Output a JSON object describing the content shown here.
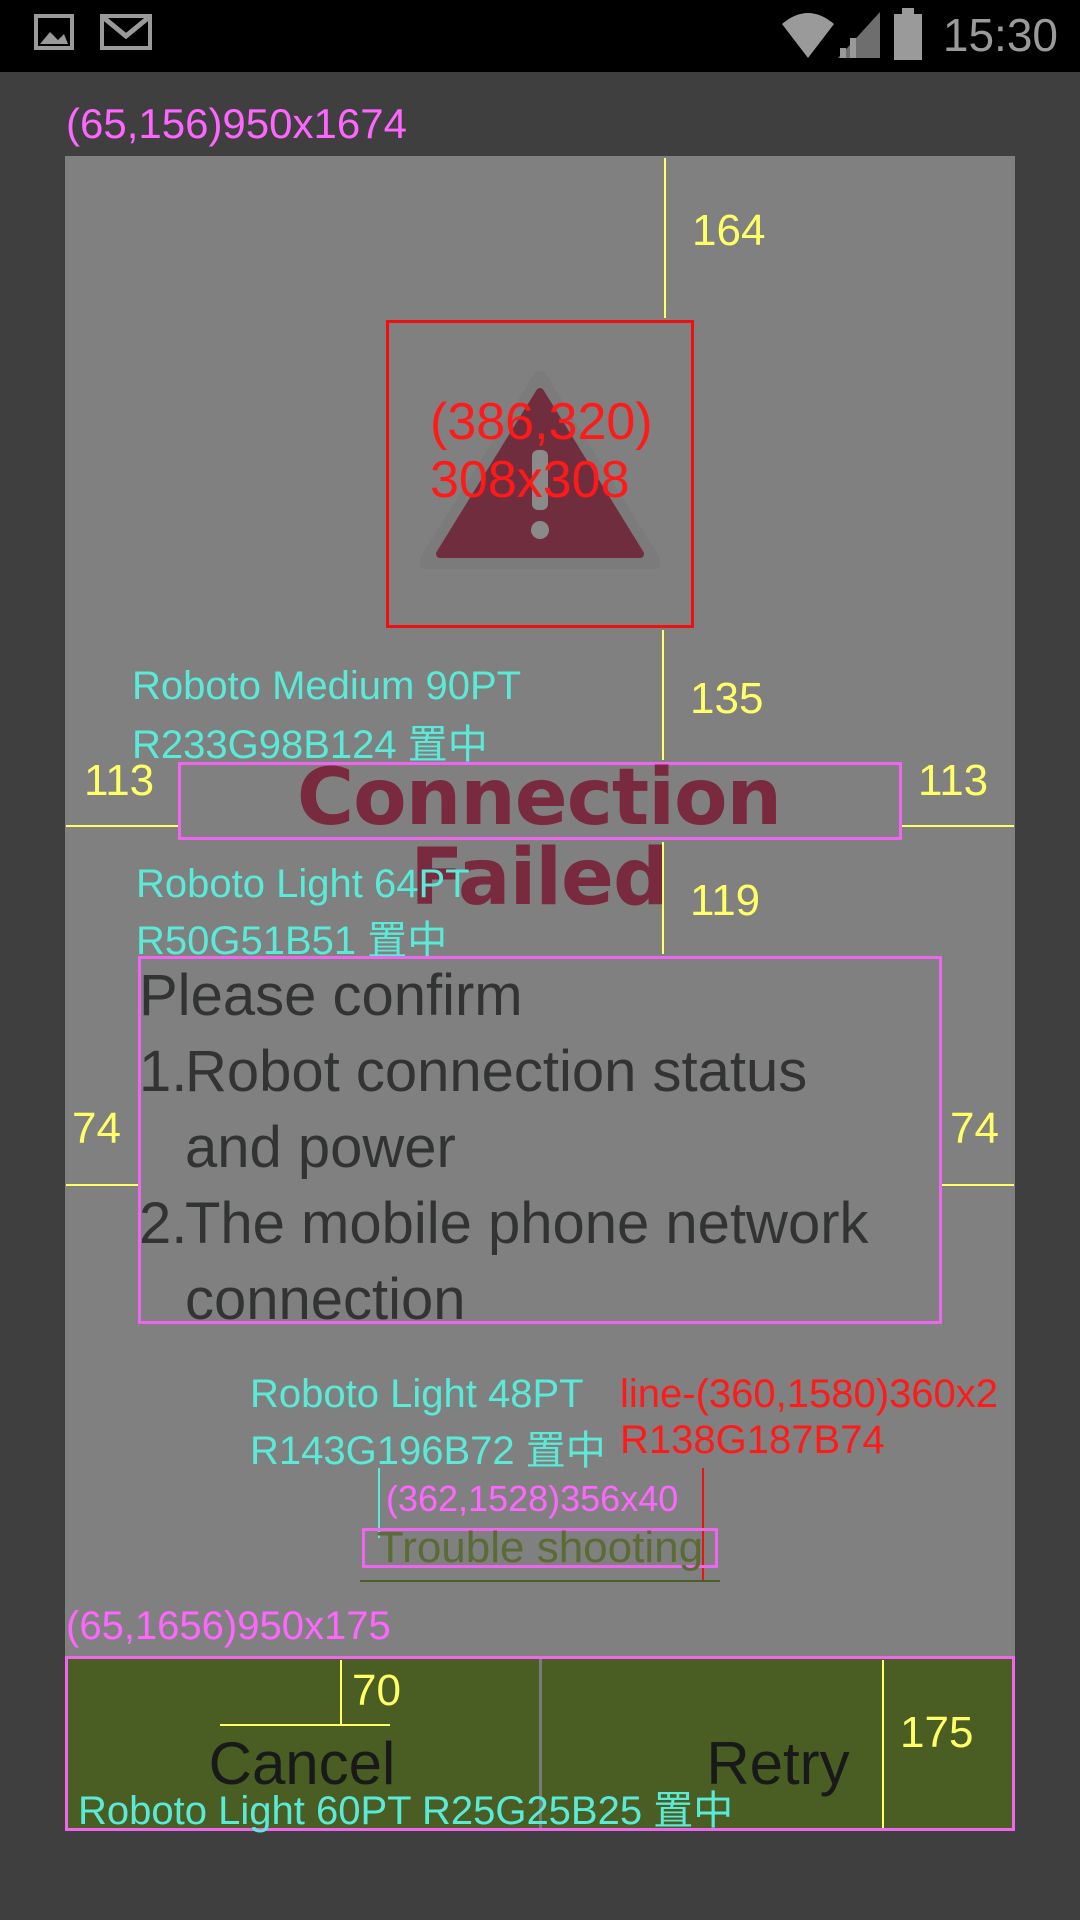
{
  "status_bar": {
    "time": "15:30"
  },
  "dialog": {
    "title": "Connection Failed",
    "message": {
      "intro": "Please confirm",
      "items": [
        {
          "num": "1.",
          "line1": "Robot connection status",
          "line2": "and power"
        },
        {
          "num": "2.",
          "line1": "The mobile phone network",
          "line2": "connection"
        }
      ]
    },
    "troubleshooting_link": "Trouble shooting",
    "buttons": {
      "cancel": "Cancel",
      "retry": "Retry"
    }
  },
  "annotations": {
    "dialog_frame": "(65,156)950x1674",
    "gap_top": "164",
    "icon_coord": "(386,320)",
    "icon_size": "308x308",
    "gap_icon_title": "135",
    "title_font": "Roboto Medium 90PT",
    "title_color": "R233G98B124 置中",
    "title_margin_left": "113",
    "title_margin_right": "113",
    "msg_font": "Roboto Light 64PT",
    "msg_color": "R50G51B51 置中",
    "gap_title_msg": "119",
    "msg_margin_left": "74",
    "msg_margin_right": "74",
    "link_font": "Roboto Light 48PT",
    "link_color": "R143G196B72 置中",
    "line_spec": "line-(360,1580)360x2",
    "line_color": "R138G187B74",
    "link_box": "(362,1528)356x40",
    "button_frame": "(65,1656)950x175",
    "button_text_offset": "70",
    "button_height": "175",
    "button_font": "Roboto Light 60PT R25G25B25 置中"
  },
  "colors": {
    "title": "#7a2a3e",
    "message": "#323333",
    "link": "#5a6b35",
    "button_bar": "#4a5e24",
    "dialog_bg": "#808080",
    "annotation_magenta": "#ff66ff",
    "annotation_cyan": "#59ead8",
    "annotation_yellow": "#ffff66",
    "annotation_red": "#ff1a1a"
  },
  "icons": [
    "image-icon",
    "gmail-icon",
    "wifi-icon",
    "signal-icon",
    "battery-icon",
    "warning-icon"
  ]
}
